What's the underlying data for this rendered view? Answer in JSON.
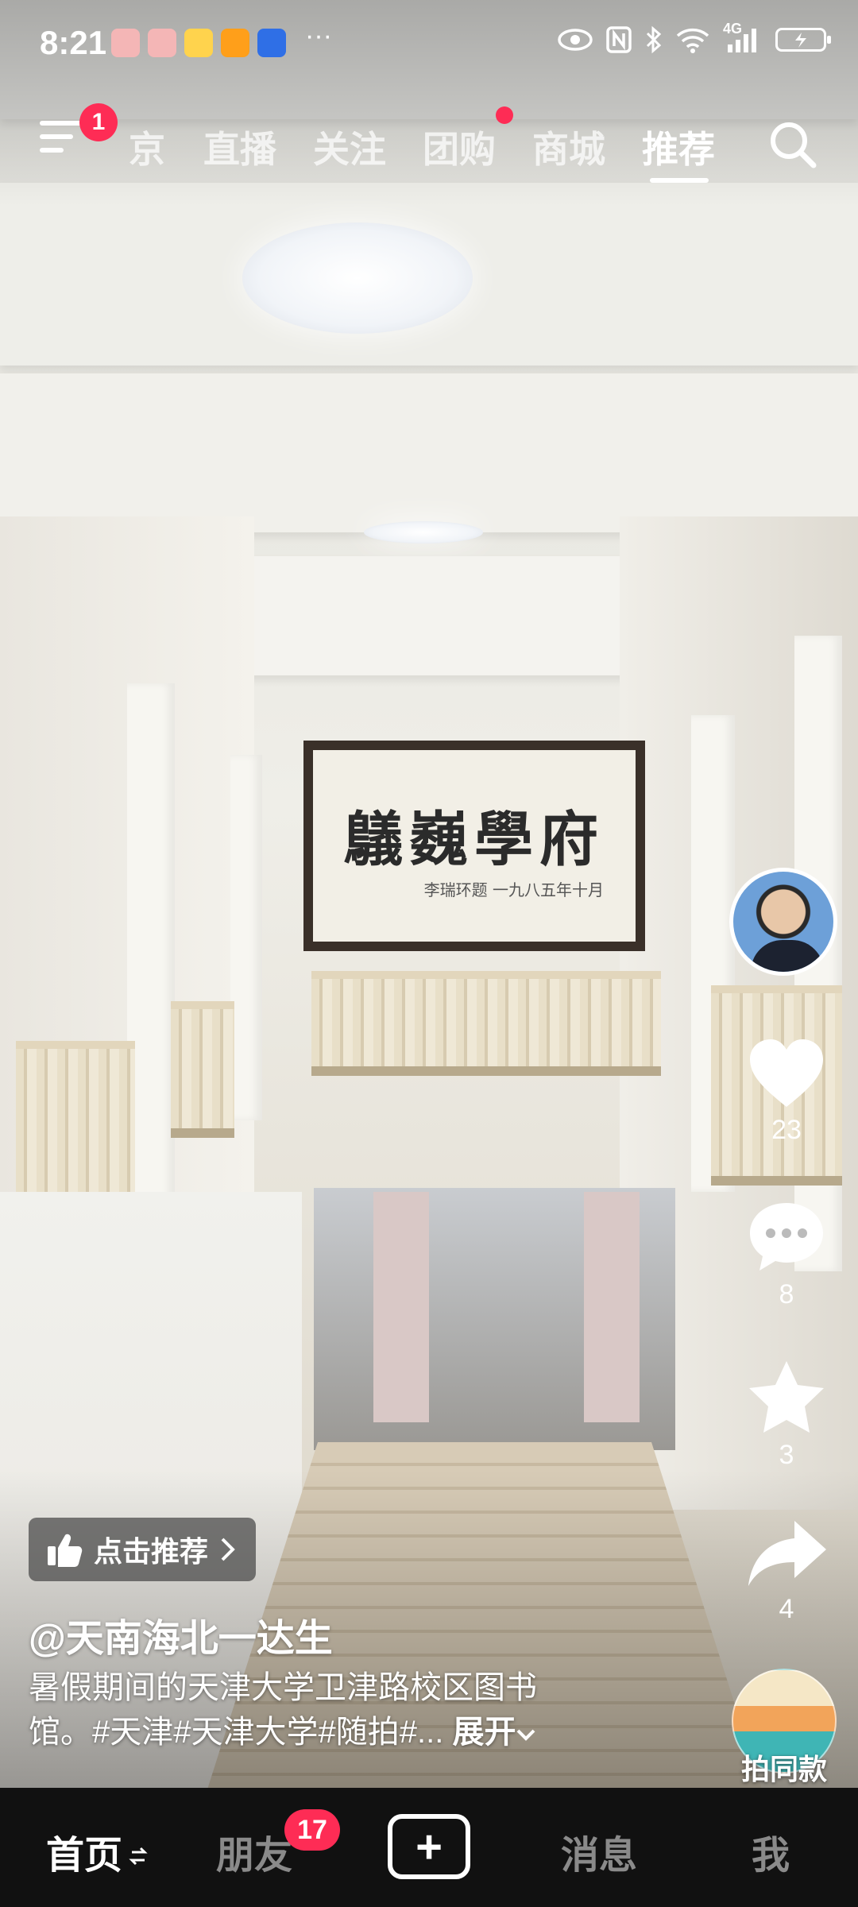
{
  "status_bar": {
    "time": "8:21",
    "more": "···",
    "network": "4G"
  },
  "top_nav": {
    "menu_badge": "1",
    "tabs": [
      {
        "label": "京",
        "active": false
      },
      {
        "label": "直播",
        "active": false
      },
      {
        "label": "关注",
        "active": false
      },
      {
        "label": "团购",
        "active": false,
        "dot": true
      },
      {
        "label": "商城",
        "active": false
      },
      {
        "label": "推荐",
        "active": true
      }
    ],
    "search_icon": "search-icon"
  },
  "artwork": {
    "calligraphy_text": "鸃巍學府",
    "signature": "李瑞环题 一九八五年十月"
  },
  "actions": {
    "like_count": "23",
    "comment_count": "8",
    "favorite_count": "3",
    "share_count": "4",
    "remix_label": "拍同款"
  },
  "video_info": {
    "recommend_label": "点击推荐",
    "author": "@天南海北一达生",
    "caption_line1": "暑假期间的天津大学卫津路校区图书",
    "caption_line2": "馆。#天津#天津大学#随拍#...",
    "expand_label": "展开"
  },
  "bottom_bar": {
    "home": "首页",
    "friends": "朋友",
    "friends_badge": "17",
    "plus": "+",
    "messages": "消息",
    "me": "我"
  },
  "colors": {
    "accent": "#fe2c55",
    "tabbar_bg": "#111111"
  }
}
